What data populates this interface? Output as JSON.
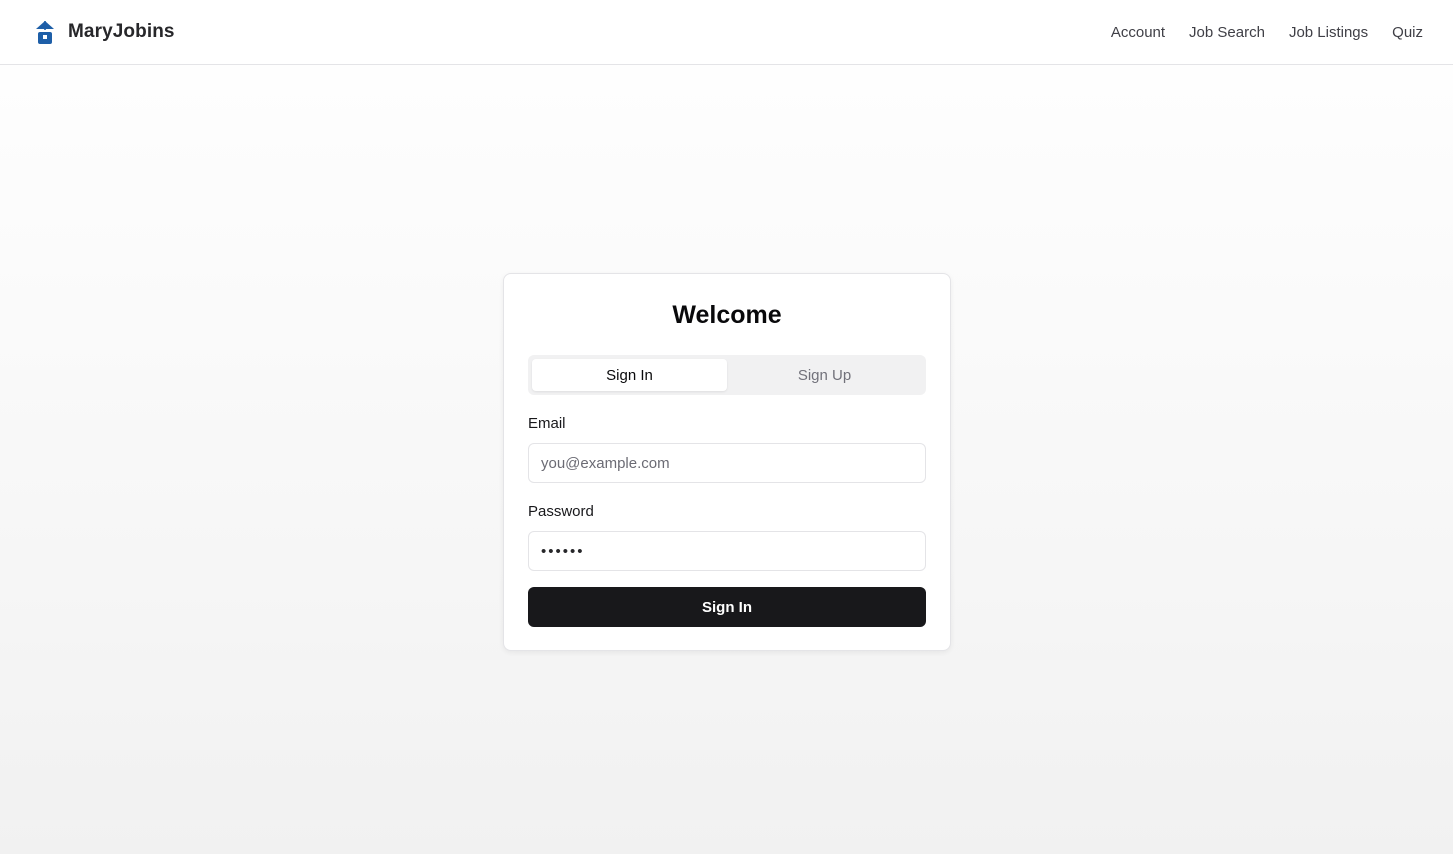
{
  "header": {
    "brand_name": "MaryJobins",
    "brand_icon": "umbrella-house-icon",
    "nav": [
      {
        "label": "Account"
      },
      {
        "label": "Job Search"
      },
      {
        "label": "Job Listings"
      },
      {
        "label": "Quiz"
      }
    ]
  },
  "auth_card": {
    "title": "Welcome",
    "tabs": [
      {
        "label": "Sign In",
        "active": true
      },
      {
        "label": "Sign Up",
        "active": false
      }
    ],
    "email": {
      "label": "Email",
      "placeholder": "you@example.com",
      "value": ""
    },
    "password": {
      "label": "Password",
      "value": "••••••"
    },
    "submit_label": "Sign In"
  },
  "colors": {
    "brand_blue": "#1e5fa8",
    "button_bg": "#18181b"
  }
}
